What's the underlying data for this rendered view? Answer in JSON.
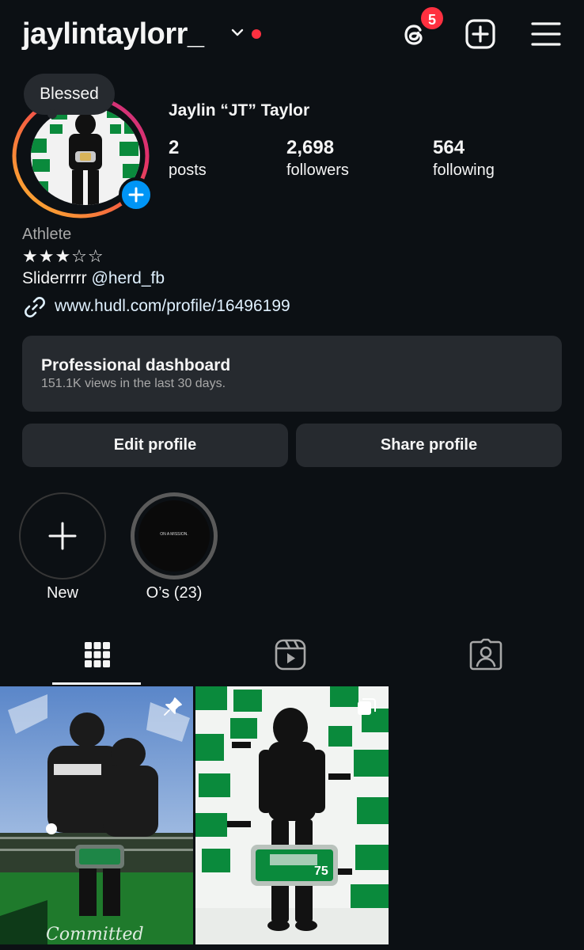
{
  "header": {
    "username": "jaylintaylorr_",
    "threads_badge": "5"
  },
  "profile": {
    "note": "Blessed",
    "display_name": "Jaylin “JT” Taylor",
    "stats": [
      {
        "value": "2",
        "label": "posts"
      },
      {
        "value": "2,698",
        "label": "followers"
      },
      {
        "value": "564",
        "label": "following"
      }
    ],
    "category": "Athlete",
    "stars": "★★★☆☆",
    "bio_text": "Sliderrrrr ",
    "bio_mention": "@herd_fb",
    "link": "www.hudl.com/profile/16496199"
  },
  "dashboard": {
    "title": "Professional dashboard",
    "subtitle": "151.1K views in the last 30 days."
  },
  "buttons": {
    "edit": "Edit profile",
    "share": "Share profile"
  },
  "highlights": [
    {
      "label": "New",
      "cover_text": ""
    },
    {
      "label": "O’s (23)",
      "cover_text": "ON A MISSION."
    }
  ],
  "colors": {
    "background": "#0c1014",
    "surface": "#262a2f",
    "accent_blue": "#0095f6",
    "notification_red": "#ff3040",
    "link_blue": "#e0f1ff",
    "marshall_green": "#00b140"
  },
  "icons": {
    "threads": "threads-icon",
    "new_post": "plus-square-icon",
    "menu": "hamburger-menu-icon",
    "link": "link-chain-icon",
    "grid_tab": "grid-icon",
    "reels_tab": "reels-icon",
    "tagged_tab": "tagged-person-icon",
    "pin": "pin-icon",
    "carousel": "carousel-icon"
  }
}
